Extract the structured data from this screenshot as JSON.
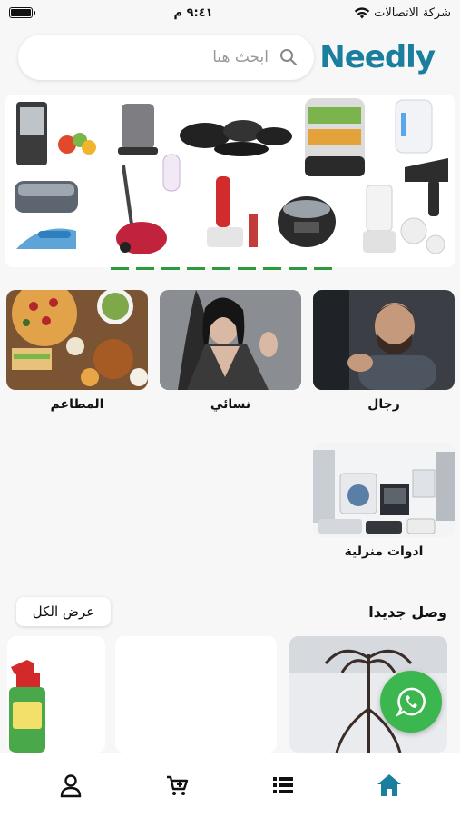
{
  "status_bar": {
    "carrier": "شركة الاتصالات",
    "time": "٩:٤١ م",
    "battery_level": 1.0
  },
  "header": {
    "logo": "Needly",
    "search_placeholder": "ابحث هنا"
  },
  "categories": [
    {
      "label": "رجال"
    },
    {
      "label": "نسائي"
    },
    {
      "label": "المطاعم"
    },
    {
      "label": "ادوات منزلية"
    }
  ],
  "new_arrivals": {
    "title": "وصل جديدا",
    "view_all": "عرض الكل"
  },
  "icons": {
    "search": "search-icon",
    "whatsapp": "whatsapp-icon",
    "home": "home-icon",
    "list": "list-icon",
    "cart": "cart-icon",
    "profile": "user-icon"
  },
  "colors": {
    "brand": "#1a7f9f",
    "whatsapp": "#3cb64f",
    "banner_indicator": "#2e9a3f",
    "nav_active": "#1a7f9f"
  }
}
